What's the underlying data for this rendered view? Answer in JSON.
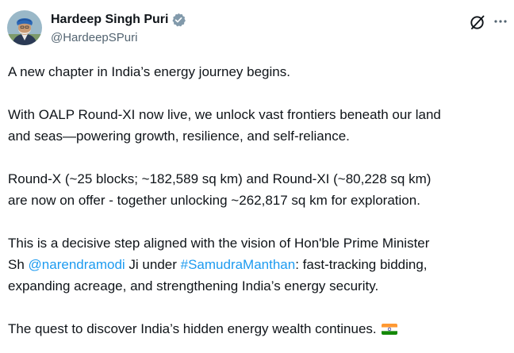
{
  "author": {
    "name": "Hardeep Singh Puri",
    "handle": "@HardeepSPuri",
    "verified": true
  },
  "icons": {
    "verified": "verified-badge-icon",
    "grok": "grok-icon",
    "more": "more-icon",
    "flag": "india-flag-icon"
  },
  "colors": {
    "text": "#0f1419",
    "secondary": "#536471",
    "link": "#1d9bf0"
  },
  "tweet": {
    "p1": "A new chapter in India’s energy journey begins.",
    "p2_line1": "With OALP Round-XI now live, we unlock vast frontiers beneath our land",
    "p2_line2": "and seas—powering growth, resilience, and self-reliance.",
    "p3_line1": "Round-X (~25 blocks; ~182,589 sq km) and Round-XI (~80,228 sq km)",
    "p3_line2": "are now on offer - together unlocking ~262,817 sq km for exploration.",
    "p4_line1": "This is a decisive step aligned with the vision of Hon'ble Prime Minister",
    "p4_sh": "Sh ",
    "p4_mention": "@narendramodi",
    "p4_ji": " Ji under ",
    "p4_hashtag": "#SamudraManthan",
    "p4_rest": ": fast-tracking bidding,",
    "p4_line3": "expanding acreage, and strengthening India’s energy security.",
    "p5": "The quest to discover India’s hidden energy wealth continues. "
  }
}
